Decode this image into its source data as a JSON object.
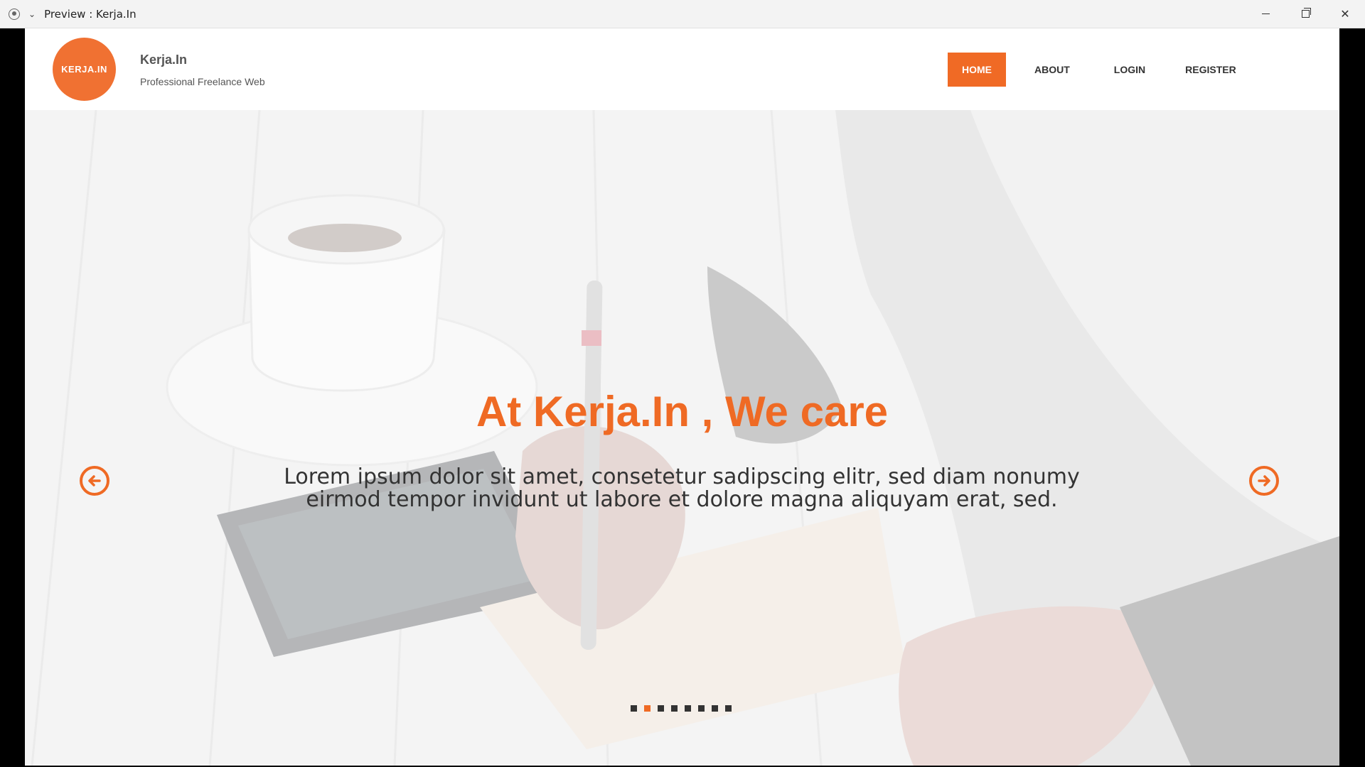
{
  "window": {
    "title": "Preview : Kerja.In",
    "app_icon": "record-icon",
    "menu_icon": "chevron-down-icon"
  },
  "site": {
    "logo_text": "KERJA.IN",
    "brand_name": "Kerja.In",
    "tagline": "Professional Freelance Web",
    "accent_color": "#f06a25"
  },
  "nav": {
    "items": [
      {
        "label": "HOME",
        "active": true
      },
      {
        "label": "ABOUT",
        "active": false
      },
      {
        "label": "LOGIN",
        "active": false
      },
      {
        "label": "REGISTER",
        "active": false
      }
    ]
  },
  "hero": {
    "title": "At Kerja.In , We care",
    "text": "Lorem ipsum dolor sit amet, consetetur sadipscing elitr, sed diam nonumy eirmod tempor invidunt ut labore et dolore magna aliquyam erat, sed.",
    "prev_icon": "arrow-left-circle-icon",
    "next_icon": "arrow-right-circle-icon",
    "slide_count": 8,
    "active_slide_index": 1
  }
}
